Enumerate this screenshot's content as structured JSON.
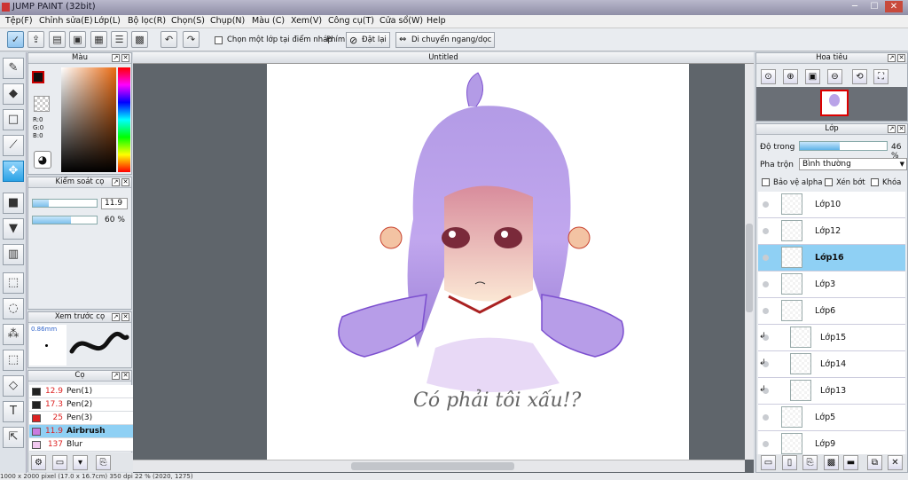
{
  "window": {
    "title": "JUMP PAINT (32bit)"
  },
  "menu": [
    "Tệp(F)",
    "Chỉnh sửa(E)",
    "Lớp(L)",
    "Bộ lọc(R)",
    "Chọn(S)",
    "Chụp(N)",
    "Màu (C)",
    "Xem(V)",
    "Công cụ(T)",
    "Cửa sổ(W)",
    "Help"
  ],
  "toolbar": {
    "sample_layer_label": "Chọn một lớp tại điểm nháp",
    "key_label": "Phím",
    "reset_label": "Đặt lại",
    "flip_label": "Di chuyển ngang/dọc"
  },
  "panels": {
    "color": {
      "title": "Màu",
      "r": "R:0",
      "g": "G:0",
      "b": "B:0"
    },
    "brush_control": {
      "title": "Kiểm soát cọ",
      "size_value": "11.9",
      "size_fill": 0.25,
      "opacity_value": "60 %",
      "opacity_fill": 0.6
    },
    "preview": {
      "title": "Xem trước cọ",
      "size_label": "0.86mm"
    },
    "brush": {
      "title": "Cọ",
      "items": [
        {
          "size": "12.9",
          "name": "Pen(1)",
          "color": "#222222"
        },
        {
          "size": "17.3",
          "name": "Pen(2)",
          "color": "#222222"
        },
        {
          "size": "25",
          "name": "Pen(3)",
          "color": "#dd2222"
        },
        {
          "size": "11.9",
          "name": "Airbrush",
          "color": "#c97adf"
        },
        {
          "size": "137",
          "name": "Blur",
          "color": "#f2c8f0"
        }
      ]
    },
    "navigator": {
      "title": "Hoa tiêu"
    },
    "layers": {
      "title": "Lớp",
      "opacity_label": "Độ trong",
      "opacity_value": "46 %",
      "opacity_fill": 0.46,
      "blend_label": "Pha trộn",
      "blend_value": "Bình thường",
      "alpha_label": "Bảo vệ alpha",
      "clip_label": "Xén bớt",
      "lock_label": "Khóa",
      "items": [
        {
          "name": "Lớp10",
          "selected": false,
          "clipped": false
        },
        {
          "name": "Lớp12",
          "selected": false,
          "clipped": false
        },
        {
          "name": "Lớp16",
          "selected": true,
          "clipped": false
        },
        {
          "name": "Lớp3",
          "selected": false,
          "clipped": false
        },
        {
          "name": "Lớp6",
          "selected": false,
          "clipped": false
        },
        {
          "name": "Lớp15",
          "selected": false,
          "clipped": true
        },
        {
          "name": "Lớp14",
          "selected": false,
          "clipped": true
        },
        {
          "name": "Lớp13",
          "selected": false,
          "clipped": true
        },
        {
          "name": "Lớp5",
          "selected": false,
          "clipped": false
        },
        {
          "name": "Lớp9",
          "selected": false,
          "clipped": false
        }
      ]
    }
  },
  "document": {
    "title": "Untitled",
    "caption": "Có phải tôi xấu!?"
  },
  "status": {
    "text": "1000 x 2000 pixel (17.0 x 16.7cm)  350 dpi  22 %  (2020, 1275)"
  },
  "colors": {
    "accent": "#8fd0f4",
    "hair": "#a98ad8"
  }
}
